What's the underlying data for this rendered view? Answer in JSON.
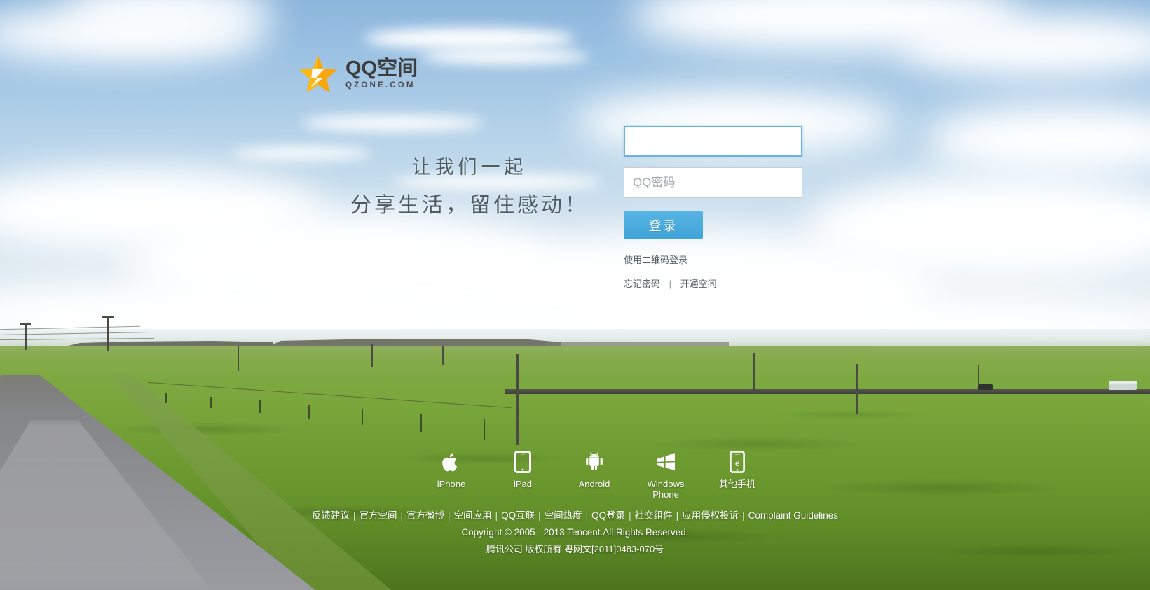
{
  "brand": {
    "logo_icon": "qzone-star-icon",
    "title": "QQ空间",
    "subtitle": "QZONE.COM"
  },
  "slogan": {
    "line1": "让我们一起",
    "line2": "分享生活，留住感动！"
  },
  "login": {
    "account": {
      "value": "",
      "placeholder": "",
      "focused": true
    },
    "password": {
      "value": "",
      "placeholder": "QQ密码"
    },
    "submit_label": "登录",
    "qr_login_label": "使用二维码登录",
    "forgot_password_label": "忘记密码",
    "separator": "|",
    "register_label": "开通空间",
    "accent_color": "#48a9dc",
    "focus_border_color": "#6ab5e0"
  },
  "platforms": [
    {
      "icon": "apple-icon",
      "label": "iPhone"
    },
    {
      "icon": "ipad-icon",
      "label": "iPad"
    },
    {
      "icon": "android-icon",
      "label": "Android"
    },
    {
      "icon": "windows-icon",
      "label": "Windows\nPhone"
    },
    {
      "icon": "other-phone-icon",
      "label": "其他手机"
    }
  ],
  "footer": {
    "links": [
      "反馈建议",
      "官方空间",
      "官方微博",
      "空间应用",
      "QQ互联",
      "空间热度",
      "QQ登录",
      "社交组件",
      "应用侵权投诉",
      "Complaint Guidelines"
    ],
    "copyright": "Copyright © 2005 - 2013 Tencent.All Rights Reserved.",
    "icp": "腾讯公司 版权所有 粤网文[2011]0483-070号"
  },
  "background": {
    "sky_color": "#9cc2e3",
    "grass_color": "#79a63b",
    "road_color": "#8d8e91"
  }
}
